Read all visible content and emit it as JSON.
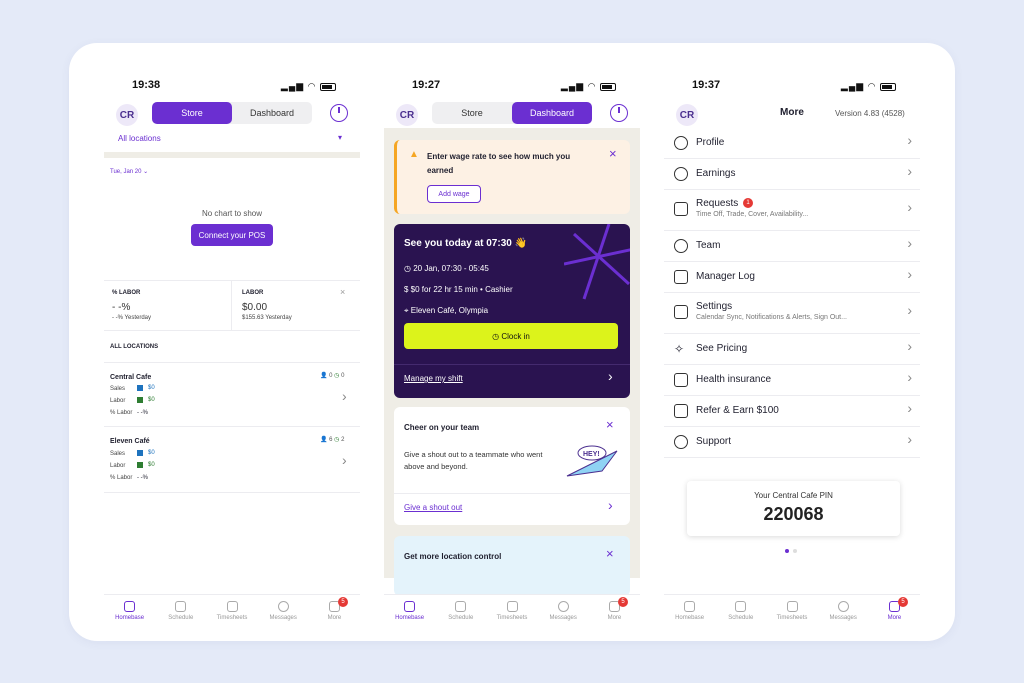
{
  "status": {
    "time1": "19:38",
    "time2": "19:27",
    "time3": "19:37"
  },
  "user": {
    "initials": "CR"
  },
  "segment": {
    "store": "Store",
    "dashboard": "Dashboard"
  },
  "screen1": {
    "locations_select": "All locations",
    "date": "Tue, Jan 20",
    "no_chart": "No chart to show",
    "connect_pos": "Connect your POS",
    "labor_pct_title": "% LABOR",
    "labor_pct_value": "- -%",
    "labor_pct_sub": "- -% Yesterday",
    "labor_title": "LABOR",
    "labor_value": "$0.00",
    "labor_sub": "$155.63 Yesterday",
    "all_locations": "ALL LOCATIONS",
    "locations": [
      {
        "name": "Central Cafe",
        "people": "0",
        "clock": "0",
        "sales_label": "Sales",
        "sales": "$0",
        "labor_label": "Labor",
        "labor": "$0",
        "pct_label": "% Labor",
        "pct": "- -%"
      },
      {
        "name": "Eleven Café",
        "people": "6",
        "clock": "2",
        "sales_label": "Sales",
        "sales": "$0",
        "labor_label": "Labor",
        "labor": "$0",
        "pct_label": "% Labor",
        "pct": "- -%"
      }
    ]
  },
  "screen2": {
    "wage_alert": "Enter wage rate to see how much you earned",
    "add_wage": "Add wage",
    "shift_title": "See you today at 07:30 👋",
    "shift_time": "20 Jan, 07:30 - 05:45",
    "shift_pay": "$0 for 22 hr 15 min • Cashier",
    "shift_location": "Eleven Café, Olympia",
    "clock_in": "Clock in",
    "manage_shift": "Manage my shift",
    "cheer_title": "Cheer on your team",
    "cheer_body": "Give a shout out to a teammate who went above and beyond.",
    "cheer_illustration": "HEY!",
    "cheer_link": "Give a shout out",
    "location_control": "Get more location control"
  },
  "screen3": {
    "title": "More",
    "version": "Version 4.83 (4528)",
    "menu": [
      {
        "label": "Profile",
        "sub": ""
      },
      {
        "label": "Earnings",
        "sub": ""
      },
      {
        "label": "Requests",
        "sub": "Time Off, Trade, Cover, Availability..."
      },
      {
        "label": "Team",
        "sub": ""
      },
      {
        "label": "Manager Log",
        "sub": ""
      },
      {
        "label": "Settings",
        "sub": "Calendar Sync, Notifications & Alerts, Sign Out..."
      },
      {
        "label": "See Pricing",
        "sub": ""
      },
      {
        "label": "Health insurance",
        "sub": ""
      },
      {
        "label": "Refer & Earn $100",
        "sub": ""
      },
      {
        "label": "Support",
        "sub": ""
      }
    ],
    "requests_badge": "1",
    "pin_label": "Your Central Cafe PIN",
    "pin": "220068"
  },
  "tabs": [
    "Homebase",
    "Schedule",
    "Timesheets",
    "Messages",
    "More"
  ],
  "more_badge": "5",
  "colors": {
    "accent": "#6b2fd1",
    "lime": "#dcf31b",
    "dark": "#2a1350"
  }
}
